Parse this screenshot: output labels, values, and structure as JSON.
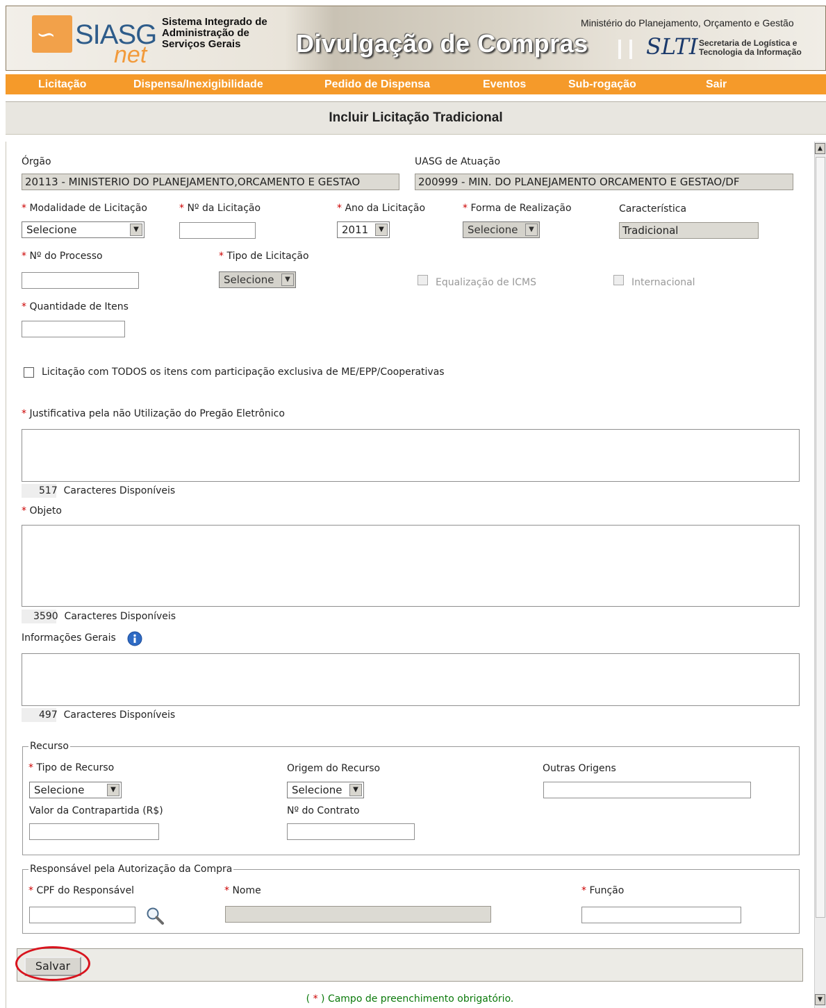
{
  "header": {
    "logo_main": "SIASG",
    "logo_sub": "net",
    "system_name_line1": "Sistema Integrado de",
    "system_name_line2": "Administração de",
    "system_name_line3": "Serviços Gerais",
    "banner_title": "Divulgação de Compras",
    "ministry": "Ministério do Planejamento, Orçamento e Gestão",
    "slti_logo": "SLTI",
    "slti_line1": "Secretaria de Logística e",
    "slti_line2": "Tecnologia da Informação"
  },
  "nav": {
    "items": [
      "Licitação",
      "Dispensa/Inexigibilidade",
      "Pedido de Dispensa",
      "Eventos",
      "Sub-rogação",
      "Sair"
    ],
    "color": "#f59a2a"
  },
  "page_title": "Incluir Licitação Tradicional",
  "required_mark": "*",
  "form": {
    "orgao_label": "Órgão",
    "orgao_value": "20113 - MINISTERIO DO PLANEJAMENTO,ORCAMENTO E GESTAO",
    "uasg_label": "UASG de Atuação",
    "uasg_value": "200999 - MIN. DO PLANEJAMENTO ORCAMENTO E GESTAO/DF",
    "modalidade_label": "Modalidade de Licitação",
    "modalidade_value": "Selecione",
    "numero_label": "Nº da Licitação",
    "ano_label": "Ano da Licitação",
    "ano_value": "2011",
    "forma_label": "Forma de Realização",
    "forma_value": "Selecione",
    "caracteristica_label": "Característica",
    "caracteristica_value": "Tradicional",
    "processo_label": "Nº do Processo",
    "tipo_label": "Tipo de Licitação",
    "tipo_value": "Selecione",
    "icms_label": "Equalização de ICMS",
    "internacional_label": "Internacional",
    "quantidade_label": "Quantidade de Itens",
    "exclusiva_label": "Licitação com TODOS os itens com participação exclusiva de ME/EPP/Cooperativas",
    "justificativa_label": "Justificativa pela não Utilização do Pregão Eletrônico",
    "justificativa_count": "517",
    "objeto_label": "Objeto",
    "objeto_count": "3590",
    "info_label": "Informações Gerais",
    "info_count": "497",
    "chars_suffix": "Caracteres Disponíveis"
  },
  "recurso": {
    "legend": "Recurso",
    "tipo_label": "Tipo de Recurso",
    "tipo_value": "Selecione",
    "origem_label": "Origem do Recurso",
    "origem_value": "Selecione",
    "outras_label": "Outras Origens",
    "contrapartida_label": "Valor da Contrapartida (R$)",
    "contrato_label": "Nº do Contrato"
  },
  "responsavel": {
    "legend": "Responsável pela Autorização da Compra",
    "cpf_label": "CPF do Responsável",
    "nome_label": "Nome",
    "funcao_label": "Função"
  },
  "actions": {
    "save_label": "Salvar"
  },
  "footer_note_open": "( ",
  "footer_note_close": " ) Campo de preenchimento obrigatório."
}
